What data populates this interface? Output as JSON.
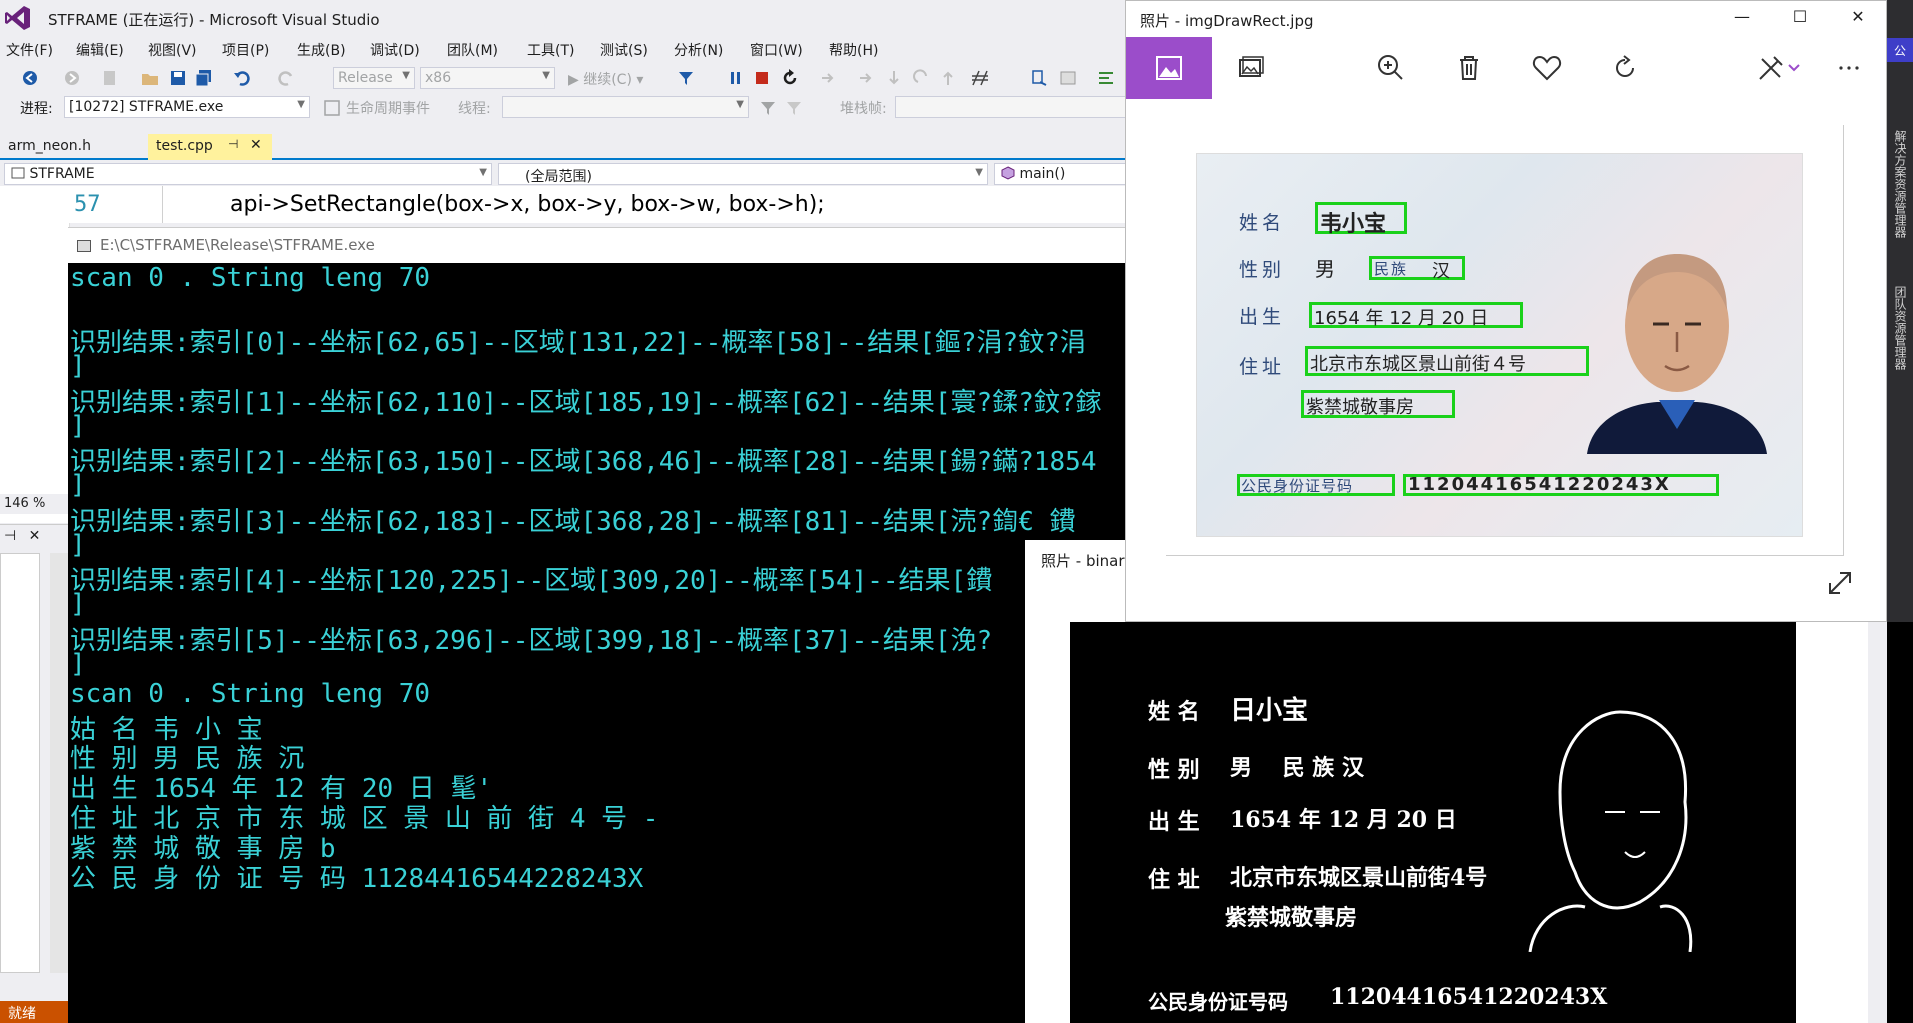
{
  "vs": {
    "title": "STFRAME (正在运行) - Microsoft Visual Studio",
    "menu": [
      "文件(F)",
      "编辑(E)",
      "视图(V)",
      "项目(P)",
      "生成(B)",
      "调试(D)",
      "团队(M)",
      "工具(T)",
      "测试(S)",
      "分析(N)",
      "窗口(W)",
      "帮助(H)"
    ],
    "toolbar": {
      "config": "Release",
      "platform": "x86",
      "continue_label": "继续(C)"
    },
    "debug_bar": {
      "process_label": "进程:",
      "process_value": "[10272] STFRAME.exe",
      "lifecycle_label": "生命周期事件",
      "thread_label": "线程:",
      "stackframe_label": "堆栈帧:"
    },
    "tabs": {
      "inactive": "arm_neon.h",
      "active": "test.cpp",
      "pin": "⊣",
      "close": "✕"
    },
    "nav": {
      "project": "STFRAME",
      "scope": "(全局范围)",
      "member": "main()"
    },
    "editor": {
      "line_number": "57",
      "code": "api->SetRectangle(box->x, box->y, box->w, box->h);"
    },
    "zoom": "146 %",
    "status": "就绪"
  },
  "console": {
    "title": "E:\\C\\STFRAME\\Release\\STFRAME.exe",
    "lines": [
      "scan 0 . String leng 70",
      "",
      "识别结果:索引[0]--坐标[62,65]--区域[131,22]--概率[58]--结果[鏂?涓?鈫?涓",
      "]",
      "识别结果:索引[1]--坐标[62,110]--区域[185,19]--概率[62]--结果[寰?鍒?鈫?鎵",
      "]",
      "识别结果:索引[2]--坐标[63,150]--区域[368,46]--概率[28]--结果[鍚?鏋?1854",
      "]",
      "识别结果:索引[3]--坐标[62,183]--区域[368,28]--概率[81]--结果[涜?鍧€ 鐨",
      "]",
      "识别结果:索引[4]--坐标[120,225]--区域[309,20]--概率[54]--结果[鐨",
      "]",
      "识别结果:索引[5]--坐标[63,296]--区域[399,18]--概率[37]--结果[浼?",
      "]",
      "scan 0 . String leng 70",
      "姑 名 韦 小 宝",
      "性 别 男 民 族 沉",
      "出 生 1654 年 12 有 20 日 髦'",
      "住 址 北 京 市 东 城 区 景 山 前 街 4 号 -",
      "紫 禁 城 敬 事 房 b",
      "公 民 身 份 证 号 码 11284416544228243X"
    ]
  },
  "photo_binary": {
    "title": "照片 - binary",
    "rows": [
      {
        "label": "姓 名",
        "value": "日小宝"
      },
      {
        "label": "性 别",
        "value": "男    民 族 汉"
      },
      {
        "label": "出 生",
        "value": "1654 年 12 月 20 日"
      },
      {
        "label": "住 址",
        "value": "北京市东城区景山前街4号"
      },
      {
        "label": "",
        "value": "紫禁城敬事房"
      },
      {
        "label": "公民身份证号码",
        "value": "11204416541220243X"
      }
    ]
  },
  "photo_rect": {
    "title": "照片 - imgDrawRect.jpg",
    "winbuttons": [
      "—",
      "☐",
      "✕"
    ],
    "card": {
      "name_label": "姓名",
      "name": "韦小宝",
      "sex_label": "性别",
      "sex": "男",
      "ethnic_label": "民族",
      "ethnic": "汉",
      "birth_label": "出生",
      "birth": "1654 年 12 月 20 日",
      "addr_label": "住址",
      "addr1": "北京市东城区景山前街４号",
      "addr2": "紫禁城敬事房",
      "id_label": "公民身份证号码",
      "id": "11204416541220243X"
    }
  },
  "right_edge": {
    "tag": "公",
    "labels": [
      "解决方案资源管理器",
      "团队资源管理器"
    ]
  },
  "colors": {
    "accent_purple": "#9b4dca",
    "console_text": "#3ad1d6",
    "box_green": "#1ad11a",
    "vs_blue": "#007acc",
    "status_orange": "#ca5100"
  }
}
